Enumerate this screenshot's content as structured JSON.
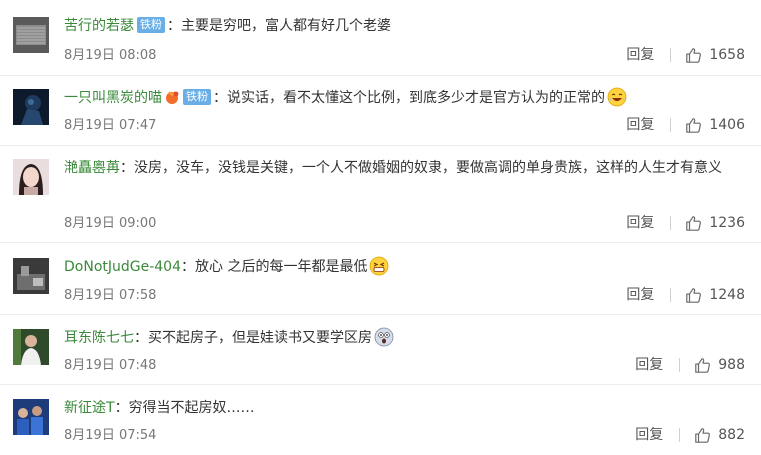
{
  "comments": [
    {
      "user": "苦行的若瑟",
      "badge": "铁粉",
      "has_badge_icon": false,
      "content": "主要是穷吧，富人都有好几个老婆",
      "emoji": "",
      "time": "8月19日 08:08",
      "reply": "回复",
      "likes": "1658"
    },
    {
      "user": "一只叫黑炭的喵",
      "badge": "铁粉",
      "has_badge_icon": true,
      "content": "说实话，看不太懂这个比例，到底多少才是官方认为的正常的",
      "emoji": "laughing-crying-emoji",
      "time": "8月19日 07:47",
      "reply": "回复",
      "likes": "1406"
    },
    {
      "user": "滟矗嶴苒",
      "badge": "",
      "has_badge_icon": false,
      "content": "没房，没车，没钱是关键，一个人不做婚姻的奴隶，要做高调的单身贵族，这样的人生才有意义",
      "emoji": "",
      "time": "8月19日 09:00",
      "reply": "回复",
      "likes": "1236"
    },
    {
      "user": "DoNotJudGe-404",
      "badge": "",
      "has_badge_icon": false,
      "content": "放心 之后的每一年都是最低",
      "emoji": "grin-emoji",
      "time": "8月19日 07:58",
      "reply": "回复",
      "likes": "1248"
    },
    {
      "user": "耳东陈七七",
      "badge": "",
      "has_badge_icon": false,
      "content": "买不起房子，但是娃读书又要学区房",
      "emoji": "shocked-emoji",
      "time": "8月19日 07:48",
      "reply": "回复",
      "likes": "988"
    },
    {
      "user": "新征途T",
      "badge": "",
      "has_badge_icon": false,
      "content": "穷得当不起房奴……",
      "emoji": "",
      "time": "8月19日 07:54",
      "reply": "回复",
      "likes": "882"
    }
  ],
  "colors": {
    "username": "#3a8a3a",
    "badge_bg": "#6aaee6",
    "meta": "#777777"
  },
  "icons": {
    "like": "thumbs-up-outline-icon"
  }
}
